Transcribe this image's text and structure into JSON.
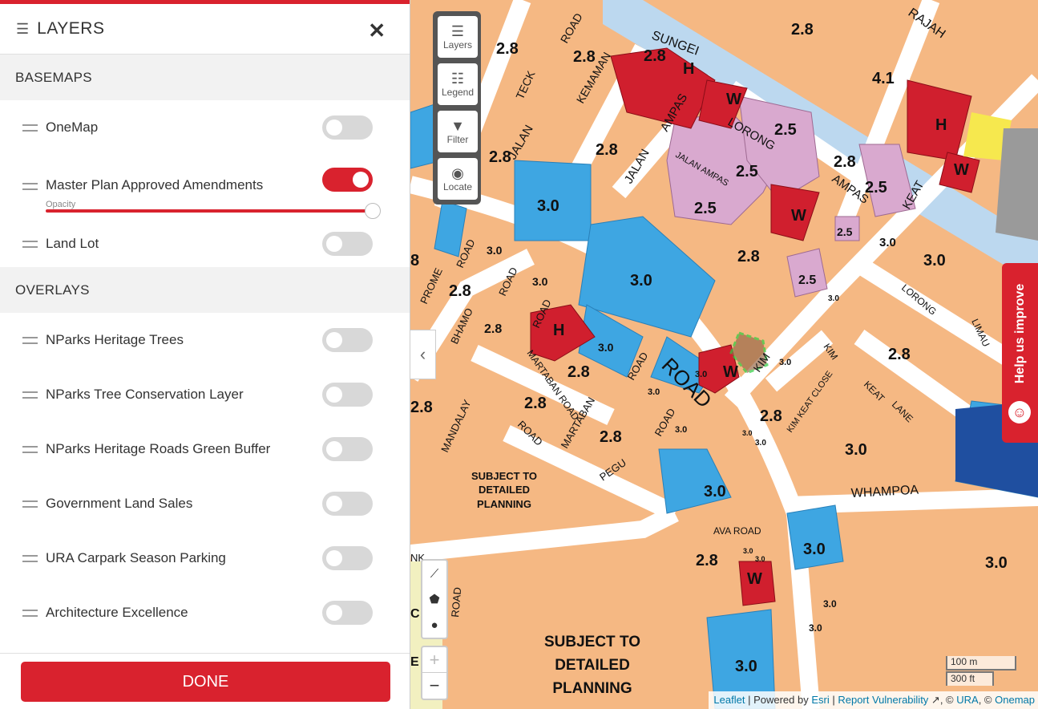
{
  "panel": {
    "title": "LAYERS",
    "close_label": "✕",
    "basemaps_title": "BASEMAPS",
    "basemaps": [
      {
        "label": "OneMap",
        "on": false
      },
      {
        "label": "Master Plan Approved Amendments",
        "on": true,
        "opacity_label": "Opacity",
        "opacity": 1.0
      },
      {
        "label": "Land Lot",
        "on": false
      }
    ],
    "overlays_title": "OVERLAYS",
    "overlays": [
      {
        "label": "NParks Heritage Trees",
        "on": false
      },
      {
        "label": "NParks Tree Conservation Layer",
        "on": false
      },
      {
        "label": "NParks Heritage Roads Green Buffer",
        "on": false
      },
      {
        "label": "Government Land Sales",
        "on": false
      },
      {
        "label": "URA Carpark Season Parking",
        "on": false
      },
      {
        "label": "Architecture Excellence",
        "on": false
      }
    ],
    "done_label": "DONE"
  },
  "map_controls": [
    {
      "label": "Layers",
      "icon": "layers-icon"
    },
    {
      "label": "Legend",
      "icon": "list-icon"
    },
    {
      "label": "Filter",
      "icon": "filter-icon"
    },
    {
      "label": "Locate",
      "icon": "locate-icon"
    }
  ],
  "draw_tools": [
    "line-icon",
    "polygon-icon",
    "circle-icon"
  ],
  "zoom": {
    "in": "+",
    "out": "−"
  },
  "help_label": "Help us improve",
  "scale": {
    "metric": "100 m",
    "imperial": "300 ft"
  },
  "attribution": {
    "leaflet": "Leaflet",
    "powered": " | Powered by ",
    "esri": "Esri",
    "sep": " | ",
    "report": "Report Vulnerability",
    "ura_sep": ", © ",
    "ura": "URA",
    "onemap_sep": ", © ",
    "onemap": "Onemap"
  },
  "map": {
    "roads": [
      "SUNGEI",
      "RAJAH",
      "TECK",
      "KEMAMAN",
      "ROAD",
      "JALAN",
      "AMPAS",
      "LORONG",
      "KEAT",
      "JALAN AMPAS",
      "PROME",
      "ROAD",
      "BHAMO",
      "ROAD",
      "MARTABAN ROAD",
      "ROAD",
      "MANDALAY",
      "ROAD",
      "MARTABAN",
      "ROAD",
      "PEGU",
      "ROAD",
      "KIM",
      "KIM",
      "KIM KEAT CLOSE",
      "KEAT",
      "LANE",
      "LORONG",
      "LIMAU",
      "WHAMPOA",
      "AVA ROAD",
      "ROAD",
      "NK",
      "C"
    ],
    "plot_ratios": [
      "2.8",
      "2.8",
      "2.8",
      "4.1",
      "2.5",
      "2.5",
      "2.8",
      "2.5",
      "2.8",
      "2.5",
      "2.8",
      "3.0",
      "2.5",
      "2.8",
      "3.0",
      "3.0",
      "2.8",
      "3.0",
      "2.8",
      "3.0",
      "3.0",
      "2.8",
      "3.0",
      "2.8",
      "3.0",
      "2.8",
      "2.8",
      "3.0",
      "3.0",
      "3.0",
      "2.8",
      "3.0",
      "3.0",
      "3.0",
      "3.0",
      "3.0",
      "3.0",
      "2.8",
      "3.0",
      "3.0",
      "3.0",
      "3.0",
      "2.8",
      "2.8",
      "3.0",
      "8",
      "3.0",
      "3.0",
      "3.0",
      "3.0"
    ],
    "zone_labels": [
      "H",
      "H",
      "H",
      "W",
      "W",
      "W",
      "W",
      "H",
      "W"
    ],
    "planning_notes": [
      "SUBJECT TO",
      "DETAILED",
      "PLANNING",
      "SUBJECT TO",
      "DETAILED",
      "PLANNING"
    ]
  }
}
